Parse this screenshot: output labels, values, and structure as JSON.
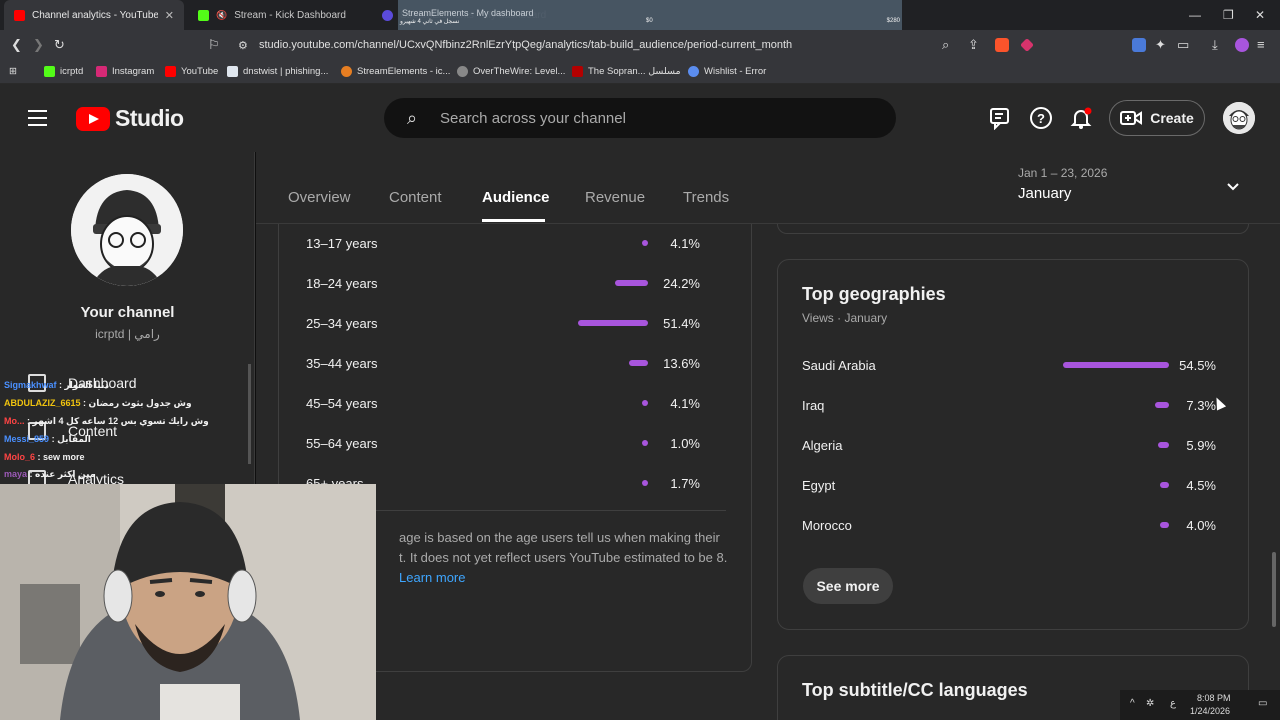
{
  "browser": {
    "tabs": [
      {
        "label": "Channel analytics - YouTube Stu",
        "active": true,
        "favicon_color": "#ff0000"
      },
      {
        "label": "Stream - Kick Dashboard",
        "active": false,
        "favicon_color": "#53fc18"
      },
      {
        "label": "StreamElements - My dashboard",
        "active": false,
        "favicon_color": "#5b4bdb"
      }
    ],
    "overlay": {
      "line1": "نسجل في ثاني 4 شهيرو",
      "line2": "$0",
      "line3": "$280"
    },
    "url": "studio.youtube.com/channel/UCxvQNfbinz2RnlEzrYtpQeg/analytics/tab-build_audience/period-current_month",
    "bookmarks": [
      "icrptd",
      "Instagram",
      "YouTube",
      "dnstwist | phishing...",
      "StreamElements - ic...",
      "OverTheWire: Level...",
      "The Sopran... مسلسل",
      "Wishlist - Error"
    ]
  },
  "header": {
    "logo_text": "Studio",
    "search_placeholder": "Search across your channel",
    "create_label": "Create"
  },
  "sidebar": {
    "channel_title": "Your channel",
    "channel_handle": "icrptd | رامي",
    "nav": [
      {
        "label": "Dashboard",
        "icon": "dashboard-icon"
      },
      {
        "label": "Content",
        "icon": "content-icon"
      },
      {
        "label": "Analytics",
        "icon": "analytics-icon"
      }
    ]
  },
  "chat": [
    {
      "user": "Sigmakhwaf",
      "text": ": دنيا الحوار",
      "color": "#4a90ff"
    },
    {
      "user": "ABDULAZIZ_6615",
      "text": ": وش جدول بثوث رمضان",
      "color": "#f1c40f"
    },
    {
      "user": "Mo...",
      "text": ": وش رايك تسوي بس 12 ساعه كل 4 اشهر",
      "color": "#ff4444"
    },
    {
      "user": "Messi_859",
      "text": ": المقابل",
      "color": "#4a90ff"
    },
    {
      "user": "Molo_6",
      "text": ": sew more",
      "color": "#ff4444"
    },
    {
      "user": "maya",
      "text": ": مين اكثر عنده",
      "color": "#9b59b6"
    }
  ],
  "tabs": {
    "items": [
      "Overview",
      "Content",
      "Audience",
      "Revenue",
      "Trends"
    ],
    "active": "Audience",
    "date_range": "Jan 1 – 23, 2026",
    "period": "January"
  },
  "age": {
    "rows": [
      {
        "label": "13–17 years",
        "value": 4.1,
        "pct": "4.1%"
      },
      {
        "label": "18–24 years",
        "value": 24.2,
        "pct": "24.2%"
      },
      {
        "label": "25–34 years",
        "value": 51.4,
        "pct": "51.4%"
      },
      {
        "label": "35–44 years",
        "value": 13.6,
        "pct": "13.6%"
      },
      {
        "label": "45–54 years",
        "value": 4.1,
        "pct": "4.1%"
      },
      {
        "label": "55–64 years",
        "value": 1.0,
        "pct": "1.0%"
      },
      {
        "label": "65+ years",
        "value": 1.7,
        "pct": "1.7%"
      }
    ],
    "note_text": "age is based on the age users tell us when making their t. It does not yet reflect users YouTube estimated to be 8.",
    "learn_more": "Learn more"
  },
  "geographies": {
    "title": "Top geographies",
    "subtitle": "Views · January",
    "rows": [
      {
        "label": "Saudi Arabia",
        "value": 54.5,
        "pct": "54.5%"
      },
      {
        "label": "Iraq",
        "value": 7.3,
        "pct": "7.3%"
      },
      {
        "label": "Algeria",
        "value": 5.9,
        "pct": "5.9%"
      },
      {
        "label": "Egypt",
        "value": 4.5,
        "pct": "4.5%"
      },
      {
        "label": "Morocco",
        "value": 4.0,
        "pct": "4.0%"
      }
    ],
    "see_more": "See more"
  },
  "subtitles_card": {
    "title": "Top subtitle/CC languages"
  },
  "taskbar": {
    "time": "8:08 PM",
    "date": "1/24/2026",
    "lang": "ع"
  },
  "colors": {
    "accent": "#a855dd",
    "link": "#3ea6ff",
    "brand_red": "#ff0000"
  }
}
